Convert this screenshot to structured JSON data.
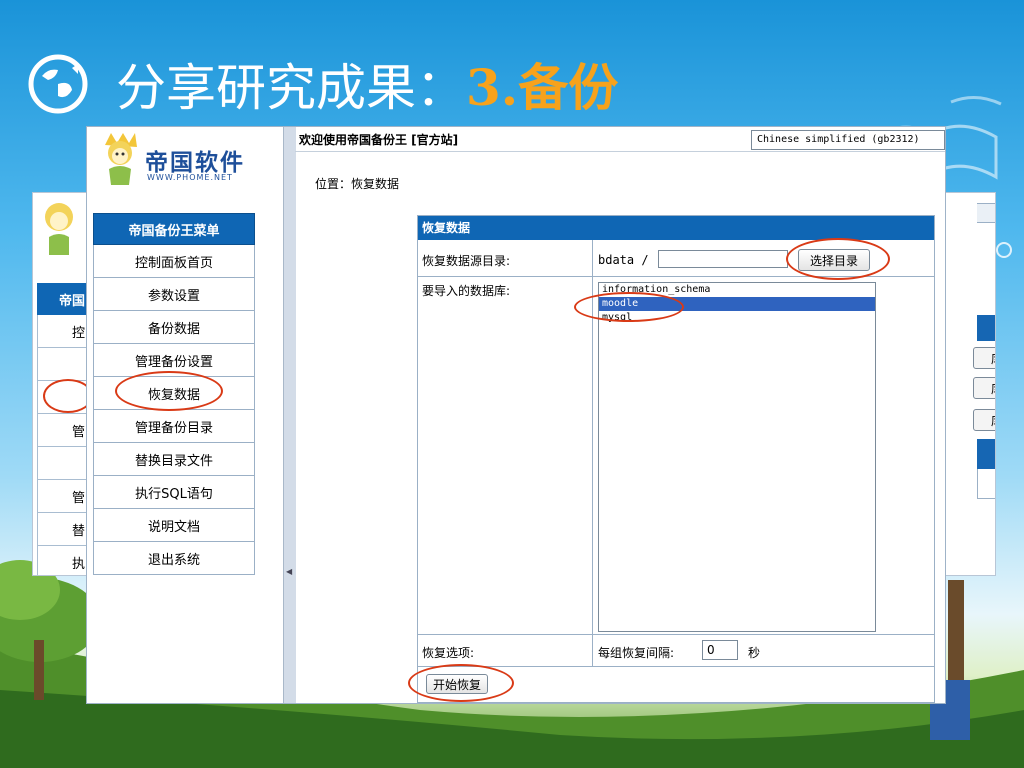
{
  "slide": {
    "title": "分享研究成果：",
    "title_accent": "3.备份",
    "icon": "restart-globe-icon",
    "colors": {
      "title": "#ffffff",
      "accent": "#f7a21b",
      "highlight_ring": "#d93a16",
      "menu_blue": "#0f66b4"
    }
  },
  "back_window": {
    "menu_header": "帝国",
    "menu_items": [
      "控",
      "",
      "",
      "管",
      "",
      "管",
      "替",
      "执"
    ],
    "buttons": [
      "库",
      "库",
      "库"
    ]
  },
  "app": {
    "logo_text": "帝国软件",
    "logo_url": "WWW.PHOME.NET",
    "welcome": "欢迎使用帝国备份王 [官方站]",
    "language": "Chinese simplified (gb2312)",
    "location": "位置：恢复数据",
    "menu": {
      "header": "帝国备份王菜单",
      "items": [
        "控制面板首页",
        "参数设置",
        "备份数据",
        "管理备份设置",
        "恢复数据",
        "管理备份目录",
        "替换目录文件",
        "执行SQL语句",
        "说明文档",
        "退出系统"
      ]
    },
    "restore": {
      "title": "恢复数据",
      "source_dir_label": "恢复数据源目录:",
      "source_dir_prefix": "bdata /",
      "source_dir_value": "",
      "select_dir_button": "选择目录",
      "db_label": "要导入的数据库:",
      "databases": [
        "information_schema",
        "moodle",
        "mysql"
      ],
      "selected_database": "moodle",
      "options_label": "恢复选项:",
      "interval_label": "每组恢复间隔:",
      "interval_value": "0",
      "interval_unit": "秒",
      "start_button": "开始恢复"
    }
  }
}
